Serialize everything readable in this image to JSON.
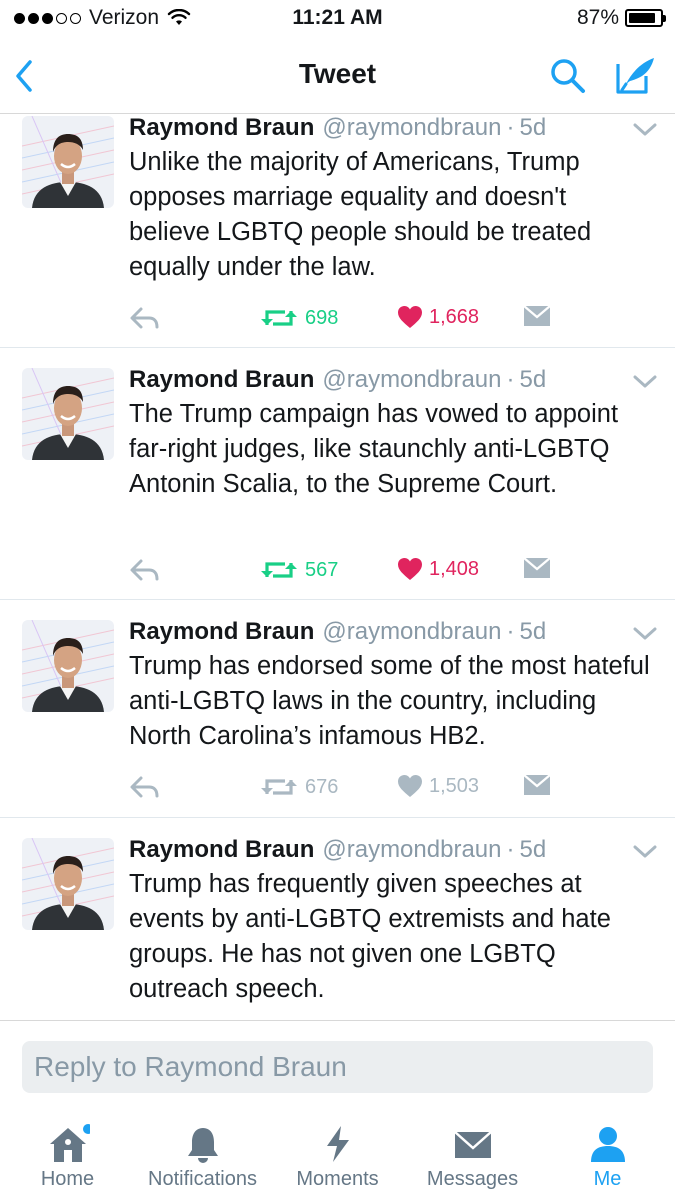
{
  "status_bar": {
    "carrier": "Verizon",
    "time": "11:21 AM",
    "battery": "87%",
    "battery_level": 0.87
  },
  "nav": {
    "title": "Tweet"
  },
  "tweets": [
    {
      "name": "Raymond Braun",
      "handle": "@raymondbraun",
      "separator": "·",
      "time": "5d",
      "text": "Unlike the majority of Americans, Trump opposes marriage equality and doesn't believe LGBTQ people should be treated equally under the law.",
      "retweets": "698",
      "likes": "1,668",
      "retweeted": true,
      "liked": true
    },
    {
      "name": "Raymond Braun",
      "handle": "@raymondbraun",
      "separator": "·",
      "time": "5d",
      "text": "The Trump campaign has vowed to appoint far-right judges, like staunchly anti-LGBTQ Antonin Scalia, to the Supreme Court.",
      "retweets": "567",
      "likes": "1,408",
      "retweeted": true,
      "liked": true
    },
    {
      "name": "Raymond Braun",
      "handle": "@raymondbraun",
      "separator": "·",
      "time": "5d",
      "text": "Trump has endorsed some of the most hateful anti-LGBTQ laws in the country, including North Carolina’s infamous HB2.",
      "retweets": "676",
      "likes": "1,503",
      "retweeted": false,
      "liked": false
    },
    {
      "name": "Raymond Braun",
      "handle": "@raymondbraun",
      "separator": "·",
      "time": "5d",
      "text": "Trump has frequently given speeches at events by anti-LGBTQ extremists and hate groups. He has not given one LGBTQ outreach speech.",
      "retweets": "",
      "likes": "",
      "retweeted": false,
      "liked": false
    }
  ],
  "reply": {
    "placeholder": "Reply to Raymond Braun"
  },
  "tabs": [
    {
      "label": "Home",
      "icon": "home-icon",
      "has_badge": true
    },
    {
      "label": "Notifications",
      "icon": "bell-icon"
    },
    {
      "label": "Moments",
      "icon": "lightning-icon"
    },
    {
      "label": "Messages",
      "icon": "envelope-icon"
    },
    {
      "label": "Me",
      "icon": "person-icon",
      "active": true
    }
  ],
  "colors": {
    "accent": "#1da1f2",
    "retweet_green": "#19cf86",
    "like_red": "#e0245e",
    "muted": "#aab8c2",
    "secondary_text": "#8899a6"
  }
}
